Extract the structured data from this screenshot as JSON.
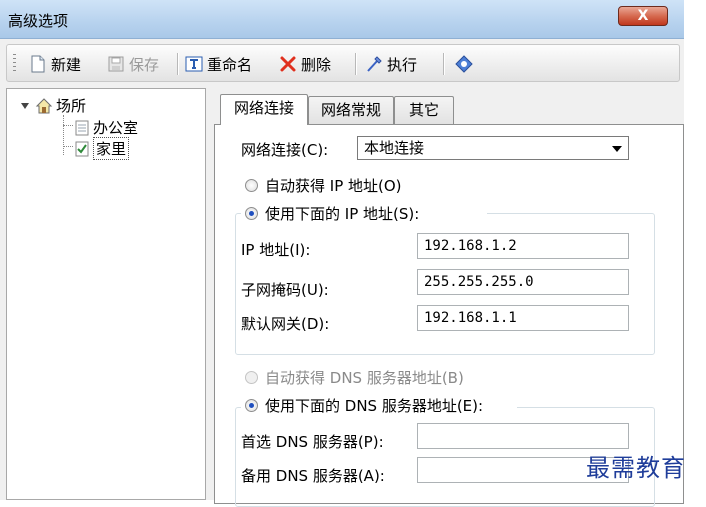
{
  "window": {
    "title": "高级选项",
    "close_label": "X"
  },
  "toolbar": {
    "new_label": "新建",
    "save_label": "保存",
    "rename_label": "重命名",
    "delete_label": "删除",
    "execute_label": "执行"
  },
  "tree": {
    "root": "场所",
    "children": [
      "办公室",
      "家里"
    ],
    "selected": "家里"
  },
  "tabs": [
    "网络连接",
    "网络常规",
    "其它"
  ],
  "network": {
    "connection_label": "网络连接(C):",
    "connection_value": "本地连接",
    "auto_ip_label": "自动获得 IP 地址(O)",
    "manual_ip_label": "使用下面的 IP 地址(S):",
    "ip_label": "IP 地址(I):",
    "ip_value": "192.168.1.2",
    "mask_label": "子网掩码(U):",
    "mask_value": "255.255.255.0",
    "gateway_label": "默认网关(D):",
    "gateway_value": "192.168.1.1",
    "auto_dns_label": "自动获得 DNS 服务器地址(B)",
    "manual_dns_label": "使用下面的 DNS 服务器地址(E):",
    "dns1_label": "首选 DNS 服务器(P):",
    "dns1_value": "",
    "dns2_label": "备用 DNS 服务器(A):",
    "dns2_value": ""
  },
  "watermark": "最需教育",
  "icons": {
    "new": "new-document-icon",
    "save": "save-disk-icon",
    "rename": "rename-icon",
    "delete": "delete-x-icon",
    "execute": "execute-wand-icon",
    "help": "help-diamond-icon",
    "root": "location-house-icon",
    "child": "checklist-icon"
  },
  "colors": {
    "delete_icon": "#e0301e",
    "radio_dot": "#1f4fbf",
    "watermark": "#1f3d9a"
  }
}
